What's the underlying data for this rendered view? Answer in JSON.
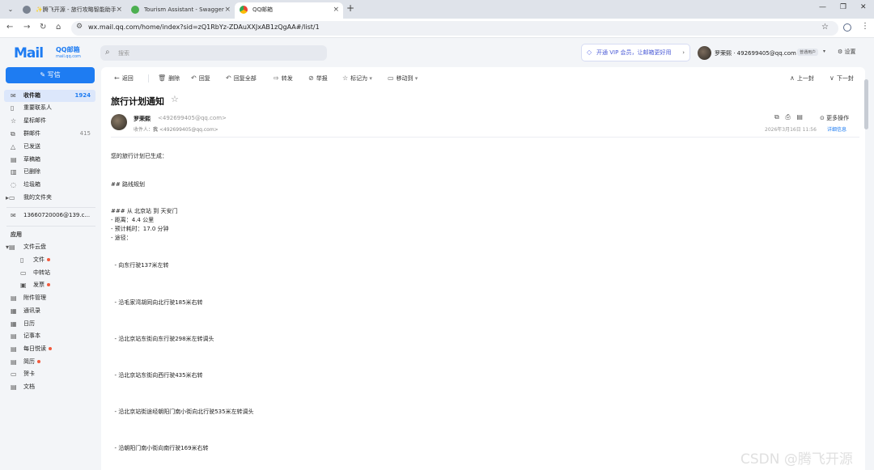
{
  "browser": {
    "tabs": [
      {
        "title": "✨腾飞开源 - 旅行攻略智能助手",
        "active": false
      },
      {
        "title": "Tourism Assistant - Swagger",
        "active": false
      },
      {
        "title": "QQ邮箱",
        "active": true
      }
    ],
    "url": "wx.mail.qq.com/home/index?sid=zQ1RbYz-ZDAuXXJxAB1zQgAA#/list/1"
  },
  "header": {
    "logo": "Mail",
    "logo_sub": "QQ邮箱",
    "logo_domain": "mail.qq.com",
    "search_placeholder": "搜索",
    "vip_promo": "开通 VIP 会员，让邮箱更好用",
    "user_name": "罗荣熙 · 492699405@qq.com",
    "user_badge": "普通用户",
    "settings_label": "设置"
  },
  "sidebar": {
    "compose_label": "写信",
    "folders": [
      {
        "label": "收件箱",
        "count": "1924",
        "icon": "inbox-icon",
        "active": true
      },
      {
        "label": "重要联系人",
        "count": "",
        "icon": "bookmark-icon"
      },
      {
        "label": "星标邮件",
        "count": "",
        "icon": "star-icon"
      },
      {
        "label": "群邮件",
        "count": "415",
        "icon": "group-mail-icon"
      },
      {
        "label": "已发送",
        "count": "",
        "icon": "sent-icon"
      },
      {
        "label": "草稿箱",
        "count": "",
        "icon": "draft-icon"
      },
      {
        "label": "已删除",
        "count": "",
        "icon": "trash-icon"
      },
      {
        "label": "垃圾箱",
        "count": "",
        "icon": "spam-icon"
      },
      {
        "label": "我的文件夹",
        "count": "",
        "icon": "folder-icon"
      }
    ],
    "account": "13660720006@139.c...",
    "apps_title": "应用",
    "apps": [
      {
        "label": "文件云盘",
        "icon": "cloud-disk-icon",
        "dot": false,
        "sub": false
      },
      {
        "label": "文件",
        "icon": "file-icon",
        "dot": true,
        "sub": true
      },
      {
        "label": "中转站",
        "icon": "transfer-icon",
        "dot": false,
        "sub": true
      },
      {
        "label": "发票",
        "icon": "invoice-icon",
        "dot": true,
        "sub": true
      },
      {
        "label": "附件管理",
        "icon": "attachment-icon",
        "dot": false,
        "sub": false
      },
      {
        "label": "通讯录",
        "icon": "contacts-icon",
        "dot": false,
        "sub": false
      },
      {
        "label": "日历",
        "icon": "calendar-icon",
        "dot": false,
        "sub": false
      },
      {
        "label": "记事本",
        "icon": "notepad-icon",
        "dot": false,
        "sub": false
      },
      {
        "label": "每日悦读",
        "icon": "reading-icon",
        "dot": true,
        "sub": false
      },
      {
        "label": "简历",
        "icon": "resume-icon",
        "dot": true,
        "sub": false
      },
      {
        "label": "贺卡",
        "icon": "card-icon",
        "dot": false,
        "sub": false
      },
      {
        "label": "文档",
        "icon": "docs-icon",
        "dot": false,
        "sub": false
      }
    ]
  },
  "toolbar": {
    "back": "返回",
    "delete": "删除",
    "reply": "回复",
    "reply_all": "回复全部",
    "forward": "转发",
    "report": "举报",
    "mark_as": "标记为",
    "move_to": "移动到",
    "prev": "上一封",
    "next": "下一封"
  },
  "email": {
    "subject": "旅行计划通知",
    "sender_name": "罗荣熙",
    "sender_addr": "<492699405@qq.com>",
    "recipient_label": "收件人：",
    "recipient_name": "我",
    "recipient_addr": "<492699405@qq.com>",
    "datetime": "2026年3月16日 11:56",
    "more_ops": "更多操作",
    "details": "详细信息",
    "body": [
      "您的旅行计划已生成：",
      "## 路线规划",
      "### 从 北京站 到 天安门",
      "- 距离：4.4 公里",
      "- 预计耗时：17.0 分钟",
      "- 途径：",
      "  - 向东行驶137米左转",
      "  - 沿毛家湾胡同向北行驶185米右转",
      "  - 沿北京站东街向东行驶298米左转调头",
      "  - 沿北京站东街向西行驶435米右转",
      "  - 沿北京站街途经朝阳门南小街向北行驶535米左转调头",
      "  - 沿朝阳门南小街向南行驶169米右转"
    ]
  },
  "watermark": "CSDN @腾飞开源"
}
